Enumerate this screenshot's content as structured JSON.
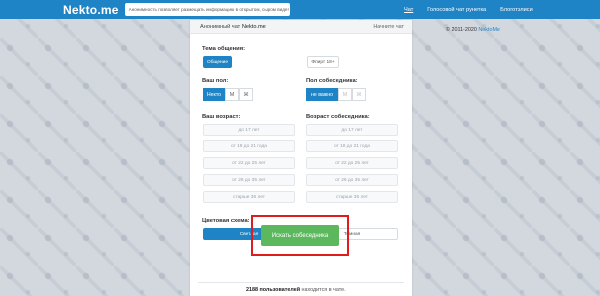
{
  "header": {
    "logo": "Nekto.me",
    "notice": "Анонимность позволяет размещать информацию в открытом, сыром виде!",
    "nav": [
      "Чат",
      "Голосовой чат рунетка",
      "Блоготэлиси"
    ]
  },
  "footer_right": {
    "copyright_prefix": "© 2011-2020",
    "copyright_link": "NektoMe"
  },
  "panel": {
    "title_prefix": "Анонимный чат",
    "title_brand": "Nekto.me",
    "restart": "Начните чат",
    "topic_label": "Тема общения:",
    "topic_options": [
      "Общение",
      "Флирт 18+"
    ],
    "your_gender_label": "Ваш пол:",
    "your_gender_options": [
      "Некто",
      "М",
      "Ж"
    ],
    "partner_gender_label": "Пол собеседника:",
    "partner_gender_options": [
      "не важно",
      "М",
      "Ж"
    ],
    "your_age_label": "Ваш возраст:",
    "partner_age_label": "Возраст собеседника:",
    "age_options": [
      "до 17 лет",
      "от 18 до 21 года",
      "от 22 до 25 лет",
      "от 26 до 35 лет",
      "старше 36 лет"
    ],
    "theme_label": "Цветовая схема:",
    "theme_options": [
      "Светлая",
      "Темная"
    ],
    "search_button": "Искать собеседника",
    "online_count": "2188 пользователей",
    "online_suffix": "находится в чате."
  }
}
